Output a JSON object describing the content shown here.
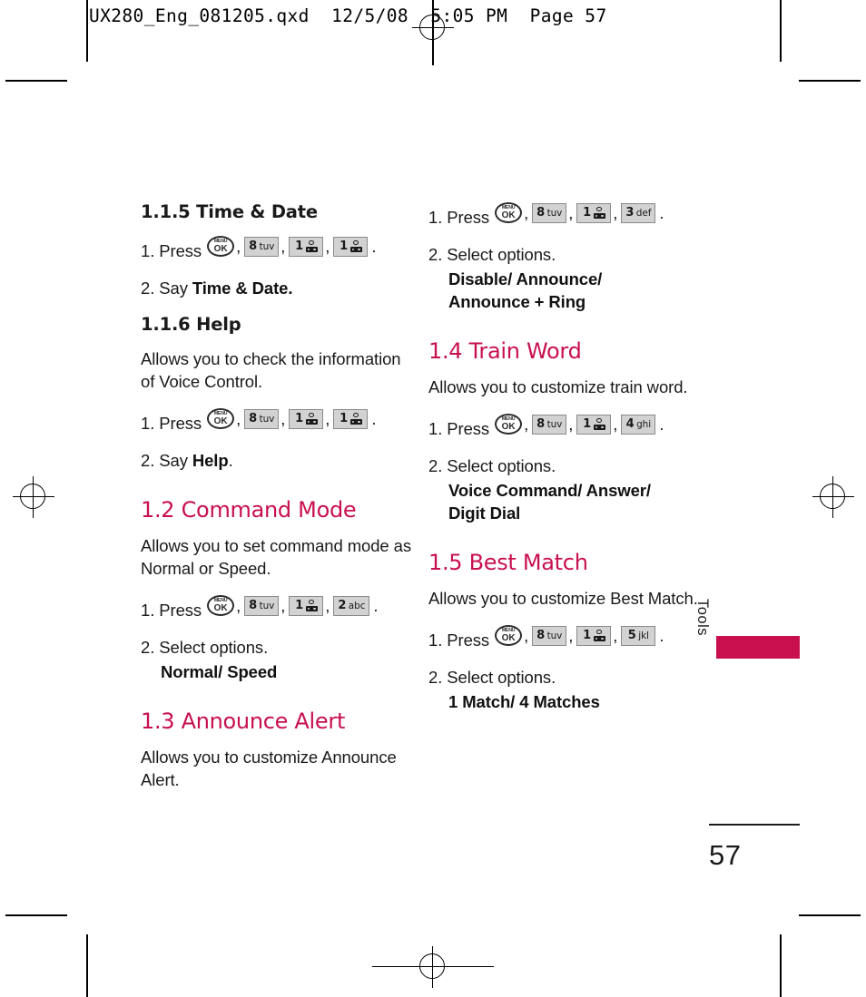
{
  "prepress": {
    "slug": "UX280_Eng_081205.qxd  12/5/08  5:05 PM  Page 57"
  },
  "folio": {
    "page_number": "57"
  },
  "thumb_tab": {
    "label": "Tools",
    "color": "#c8104e"
  },
  "colors": {
    "heading_accent": "#c8104e",
    "body_text": "#1a1a1a",
    "key_fill": "#d2d2d2",
    "key_border": "#8a8a8a"
  },
  "labels": {
    "press": "1. Press",
    "say": "2. Say",
    "select_options": "2. Select options.",
    "comma": ",",
    "period": ".",
    "menu_ok_top": "MENU",
    "menu_ok_bottom": "OK"
  },
  "keys": {
    "ok": {
      "icon": "menu-ok-key-icon",
      "top": "MENU",
      "bottom": "OK"
    },
    "k8": {
      "digit": "8",
      "letters": "tuv"
    },
    "k1": {
      "digit": "1",
      "letters": "",
      "icon": "voicemail-icon"
    },
    "k2": {
      "digit": "2",
      "letters": "abc"
    },
    "k3": {
      "digit": "3",
      "letters": "def"
    },
    "k4": {
      "digit": "4",
      "letters": "ghi"
    },
    "k5": {
      "digit": "5",
      "letters": "jkl"
    }
  },
  "left_column": {
    "sections": [
      {
        "id": "time-and-date",
        "number": "1.1.5",
        "title": "1.1.5 Time & Date",
        "style": "sub",
        "body": null,
        "press_keys": [
          "ok",
          "k8",
          "k1",
          "k1"
        ],
        "say_label": "2. Say",
        "say_value": "Time & Date.",
        "options": null
      },
      {
        "id": "help",
        "number": "1.1.6",
        "title": "1.1.6 Help",
        "style": "sub",
        "body": "Allows you to check the information of Voice Control.",
        "press_keys": [
          "ok",
          "k8",
          "k1",
          "k1"
        ],
        "say_label": "2. Say",
        "say_value": "Help",
        "say_tail": ".",
        "options": null
      },
      {
        "id": "command-mode",
        "number": "1.2",
        "title": "1.2 Command Mode",
        "style": "major",
        "body": "Allows you to set command mode as Normal or Speed.",
        "press_keys": [
          "ok",
          "k8",
          "k1",
          "k2"
        ],
        "say_label": null,
        "options_label": "2. Select options.",
        "options": "Normal/ Speed"
      },
      {
        "id": "announce-alert",
        "number": "1.3",
        "title": "1.3 Announce Alert",
        "style": "major",
        "body": "Allows you to customize Announce Alert.",
        "press_keys": null,
        "options": null
      }
    ]
  },
  "right_column": {
    "continuation": {
      "id": "announce-alert-continued",
      "press_keys": [
        "ok",
        "k8",
        "k1",
        "k3"
      ],
      "options_label": "2. Select options.",
      "options_lines": [
        "Disable/ Announce/",
        "Announce + Ring"
      ]
    },
    "sections": [
      {
        "id": "train-word",
        "number": "1.4",
        "title": "1.4 Train Word",
        "style": "major",
        "body": "Allows you to customize train word.",
        "press_keys": [
          "ok",
          "k8",
          "k1",
          "k4"
        ],
        "options_label": "2. Select options.",
        "options_lines": [
          "Voice Command/ Answer/",
          "Digit Dial"
        ]
      },
      {
        "id": "best-match",
        "number": "1.5",
        "title": "1.5 Best Match",
        "style": "major",
        "body": "Allows you to customize Best Match.",
        "press_keys": [
          "ok",
          "k8",
          "k1",
          "k5"
        ],
        "options_label": "2. Select options.",
        "options_lines": [
          "1 Match/ 4 Matches"
        ]
      }
    ]
  }
}
